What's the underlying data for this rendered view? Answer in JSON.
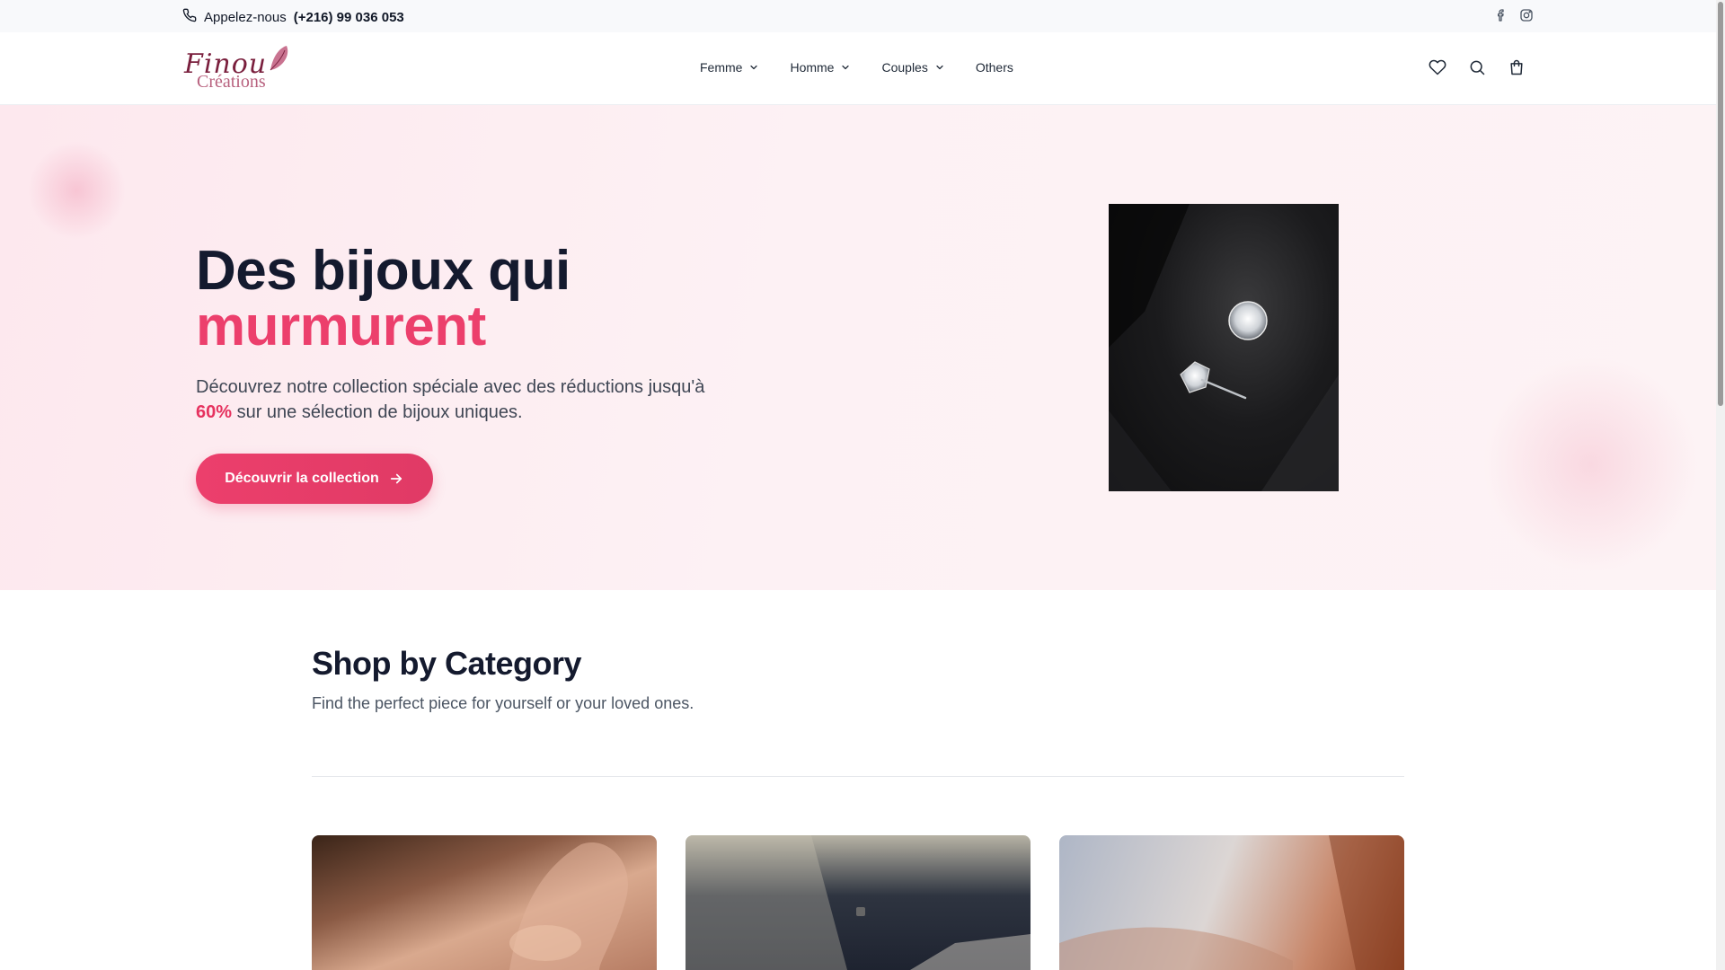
{
  "topbar": {
    "call_label": "Appelez-nous",
    "phone": "(+216) 99 036 053",
    "socials": [
      "facebook-icon",
      "instagram-icon"
    ]
  },
  "header": {
    "logo_script": "Finou",
    "logo_sub": "Créations",
    "nav": [
      {
        "label": "Femme",
        "has_dropdown": true
      },
      {
        "label": "Homme",
        "has_dropdown": true
      },
      {
        "label": "Couples",
        "has_dropdown": true
      },
      {
        "label": "Others",
        "has_dropdown": false
      }
    ],
    "icons": [
      "heart-icon",
      "search-icon",
      "shopping-bag-icon"
    ]
  },
  "hero": {
    "title_line1": "Des bijoux qui",
    "title_line2": "murmurent",
    "desc_before": "Découvrez notre collection spéciale avec des réductions jusqu'à ",
    "desc_highlight": "60%",
    "desc_after": " sur une sélection de bijoux uniques.",
    "cta_label": "Découvrir la collection"
  },
  "categories": {
    "title": "Shop by Category",
    "subtitle": "Find the perfect piece for yourself or your loved ones."
  },
  "colors": {
    "accent": "#ec3f6c",
    "title": "#141a2e",
    "hero_bg": "#fde8ee"
  }
}
